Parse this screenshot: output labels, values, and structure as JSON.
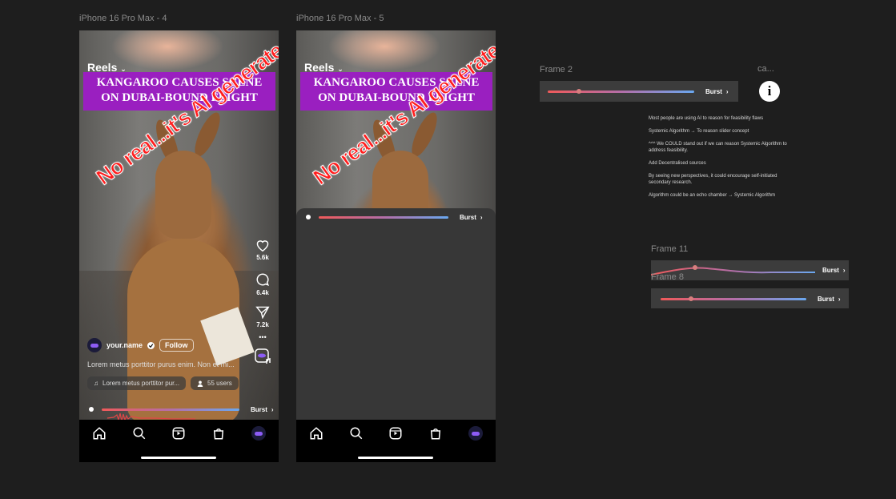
{
  "frames": {
    "phone1_label": "iPhone 16 Pro Max - 4",
    "phone2_label": "iPhone 16 Pro Max - 5",
    "frame2_label": "Frame 2",
    "frame11_label": "Frame 11",
    "frame8_label": "Frame 8",
    "ca_label": "ca..."
  },
  "reel": {
    "header": "Reels",
    "headline_line1": "KANGAROO CAUSES SCENE",
    "headline_line2": "ON DUBAI-BOUND FLIGHT",
    "overlay_text": "No real...it's AI generated",
    "username": "your.name",
    "follow_label": "Follow",
    "caption": "Lorem metus porttitor purus enim. Non et mi...",
    "music_label": "Lorem metus porttitor pur...",
    "users_label": "55 users",
    "likes": "5.6k",
    "comments": "6.4k",
    "shares": "7.2k"
  },
  "slider": {
    "label": "Burst",
    "phone1_level": 0,
    "frame2_level": 0.2,
    "frame11_level": 0.3,
    "frame8_level": 0.2
  },
  "notes": [
    "Most people are using AI to reason for feasibility flaws",
    "Systemic Algorithm → To reason slider concept",
    "^^^ We COULD stand out if we can reason Systemic Algorithm to address feasibility.",
    "Add Decentralised sources",
    "By seeing new perspectives, it could encourage self-initiated secondary research.",
    "Algorithm could be an echo chamber → Systemic Algorithm"
  ],
  "info_glyph": "i",
  "colors": {
    "canvas": "#1e1e1e",
    "headline_bg": "#9a1fc0",
    "overlay_text": "#ff1d1d",
    "slider_start": "#f05a5a",
    "slider_end": "#6aa8f0"
  },
  "icons": [
    "heart-icon",
    "comment-icon",
    "share-icon",
    "music-icon",
    "user-icon",
    "home-icon",
    "search-icon",
    "reels-icon",
    "shop-icon",
    "profile-icon",
    "chevron-right-icon",
    "info-icon"
  ]
}
